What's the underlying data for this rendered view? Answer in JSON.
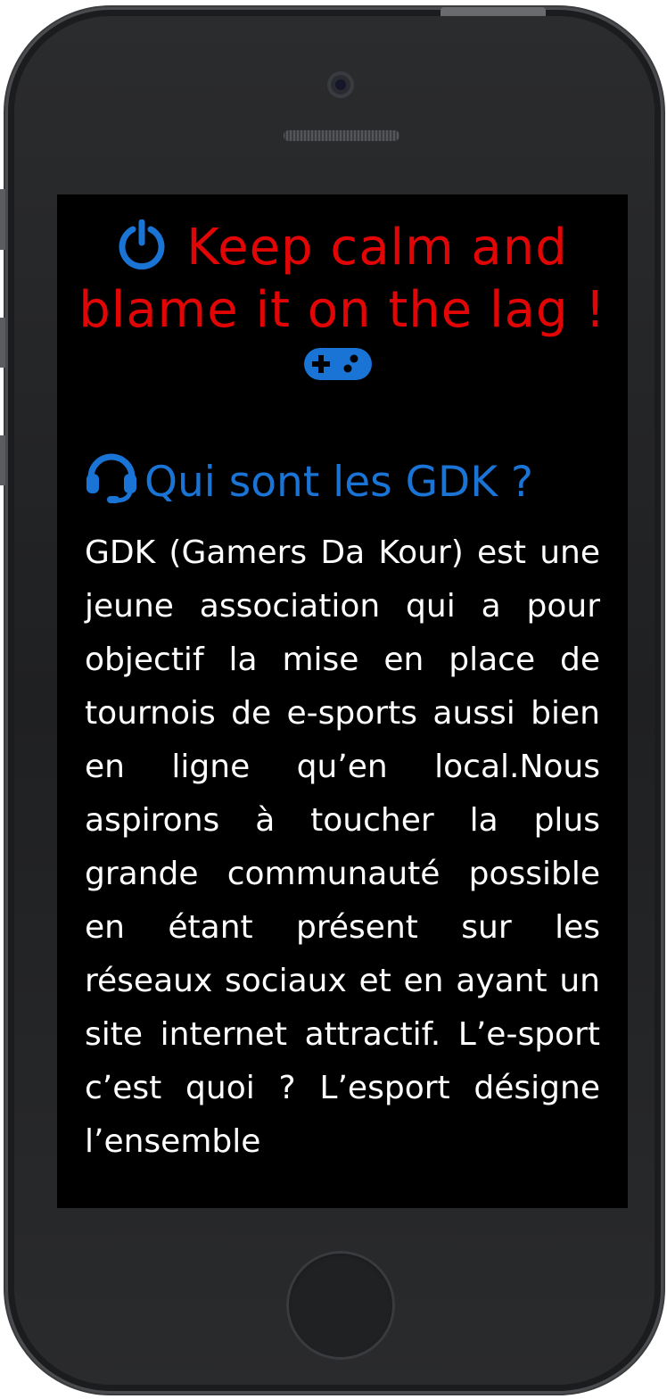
{
  "header": {
    "headline": "Keep calm and blame it on the lag !",
    "power_icon": "power-icon",
    "gamepad_icon": "gamepad-icon",
    "accent_color": "#e10505",
    "icon_color": "#1a74d6"
  },
  "section": {
    "icon": "headset-icon",
    "title": "Qui sont les GDK ?",
    "body": "GDK (Gamers Da Kour) est une jeune association qui a pour objectif la mise en place de tournois de e-sports aussi bien en ligne qu’en local.Nous aspirons à toucher la plus grande communauté possible en étant présent sur les réseaux sociaux et en ayant un site internet attractif. L’e-sport c’est quoi ? L’esport désigne l’ensemble"
  }
}
